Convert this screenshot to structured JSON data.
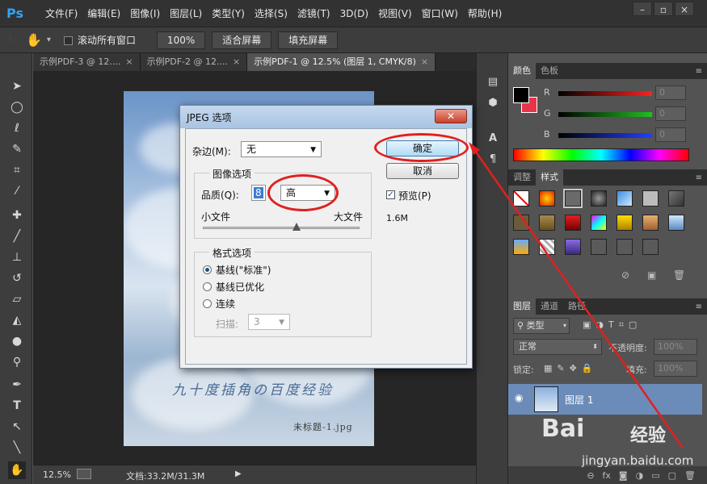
{
  "app": {
    "logo": "Ps"
  },
  "menu": [
    "文件(F)",
    "编辑(E)",
    "图像(I)",
    "图层(L)",
    "类型(Y)",
    "选择(S)",
    "滤镜(T)",
    "3D(D)",
    "视图(V)",
    "窗口(W)",
    "帮助(H)"
  ],
  "window_controls": {
    "minimize": "–",
    "restore": "▫",
    "close": "×"
  },
  "options_bar": {
    "hand_glyph": "✋",
    "dropdown_glyph": "▾",
    "scroll_all_label": "滚动所有窗口",
    "zoom_100": "100%",
    "fit_screen": "适合屏幕",
    "fill_screen": "填充屏幕"
  },
  "tabs": [
    {
      "label": "示例PDF-3 @ 12....",
      "close": "×"
    },
    {
      "label": "示例PDF-2 @ 12....",
      "close": "×"
    },
    {
      "label": "示例PDF-1 @ 12.5% (图层 1, CMYK/8)",
      "close": "×"
    }
  ],
  "document": {
    "watermark_text": "九十度插角の百度经验",
    "filename_text": "未标题-1.jpg"
  },
  "status": {
    "zoom": "12.5%",
    "doc_info": "文档:33.2M/31.3M",
    "arrow": "▶"
  },
  "color_panel": {
    "tabs": [
      "颜色",
      "色板"
    ],
    "labels": [
      "R",
      "G",
      "B"
    ],
    "values": [
      "0",
      "0",
      "0"
    ],
    "colors": {
      "foreground": "#000000",
      "background": "#e8344a",
      "red": "#ff2020",
      "green": "#20c020",
      "blue": "#2040ff"
    }
  },
  "styles_panel": {
    "tabs": [
      "调整",
      "样式"
    ]
  },
  "layers_panel": {
    "tabs": [
      "图层",
      "通道",
      "路径"
    ],
    "filter_kind": "类型",
    "blend_mode": "正常",
    "opacity_label": "不透明度:",
    "opacity_value": "100%",
    "lock_label": "锁定:",
    "fill_label": "填充:",
    "fill_value": "100%",
    "layer_name": "图层 1",
    "eye_glyph": "◉",
    "bottom_icons": [
      "link-icon",
      "fx-icon",
      "mask-icon",
      "adjustment-icon",
      "group-icon",
      "new-layer-icon",
      "trash-icon"
    ],
    "bottom_glyphs": [
      "⊖",
      "fx",
      "◙",
      "◑",
      "▭",
      "▢",
      "🗑"
    ]
  },
  "dialog": {
    "title": "JPEG 选项",
    "close": "✕",
    "matte_label": "杂边(M):",
    "matte_value": "无",
    "image_options_title": "图像选项",
    "quality_label": "品质(Q):",
    "quality_value": "8",
    "quality_level": "高",
    "small_file": "小文件",
    "large_file": "大文件",
    "quality_slider_fraction": 0.6,
    "format_options_title": "格式选项",
    "radio_baseline_std": "基线(\"标准\")",
    "radio_baseline_opt": "基线已优化",
    "radio_progressive": "连续",
    "scans_label": "扫描:",
    "scans_value": "3",
    "ok": "确定",
    "cancel": "取消",
    "preview_label": "预览(P)",
    "file_size": "1.6M",
    "arrow_glyph": "▼"
  },
  "watermark": {
    "brand": "Bai",
    "brand2": "经验",
    "site": "jingyan.baidu.com"
  }
}
